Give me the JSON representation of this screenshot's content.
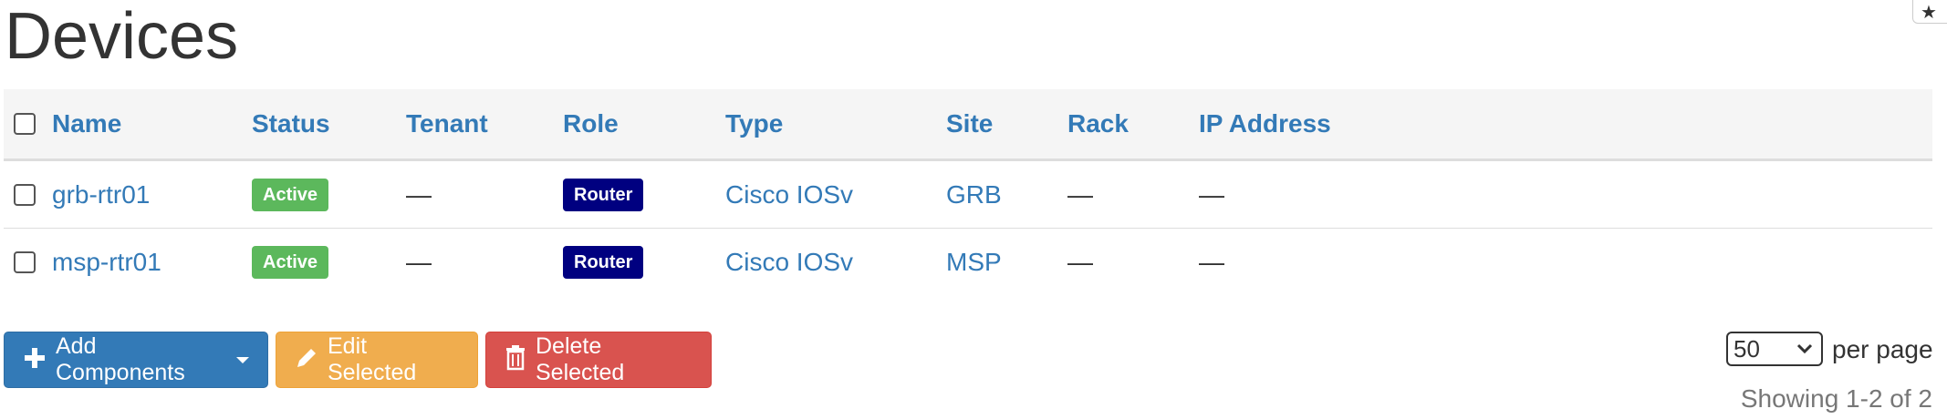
{
  "page": {
    "title": "Devices"
  },
  "table": {
    "columns": [
      "Name",
      "Status",
      "Tenant",
      "Role",
      "Type",
      "Site",
      "Rack",
      "IP Address"
    ],
    "rows": [
      {
        "name": "grb-rtr01",
        "status": "Active",
        "tenant": "—",
        "role": "Router",
        "type": "Cisco IOSv",
        "site": "GRB",
        "rack": "—",
        "ip": "—"
      },
      {
        "name": "msp-rtr01",
        "status": "Active",
        "tenant": "—",
        "role": "Router",
        "type": "Cisco IOSv",
        "site": "MSP",
        "rack": "—",
        "ip": "—"
      }
    ]
  },
  "actions": {
    "add_label": "Add Components",
    "edit_label": "Edit Selected",
    "delete_label": "Delete Selected"
  },
  "pagination": {
    "per_page_value": "50",
    "per_page_label": "per page",
    "showing": "Showing 1-2 of 2"
  },
  "colors": {
    "link": "#337ab7",
    "active_badge": "#5cb85c",
    "role_badge": "#000080",
    "add_button": "#337ab7",
    "edit_button": "#f0ad4e",
    "delete_button": "#d9534f"
  }
}
